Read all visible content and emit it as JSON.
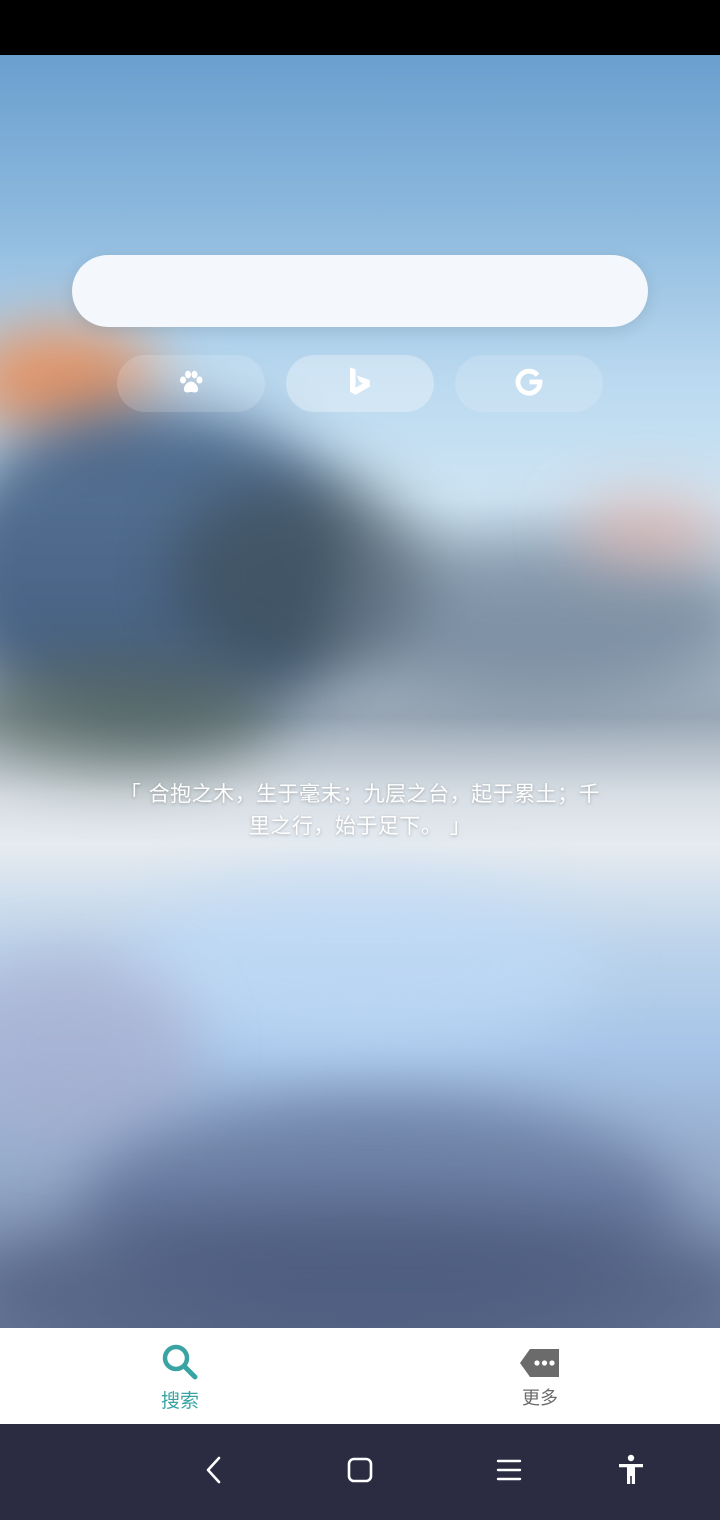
{
  "search": {
    "value": "",
    "placeholder": ""
  },
  "engines": [
    {
      "name": "baidu",
      "icon": "paw-icon",
      "selected": false
    },
    {
      "name": "bing",
      "icon": "bing-logo-icon",
      "selected": true
    },
    {
      "name": "google",
      "icon": "google-logo-icon",
      "selected": false
    }
  ],
  "quote": {
    "text": "「 合抱之木，生于毫末；九层之台，起于累土；千里之行，始于足下。 」"
  },
  "bottom_nav": {
    "tabs": [
      {
        "label": "搜索",
        "icon": "search-icon",
        "active": true,
        "color": "#3aa4a4"
      },
      {
        "label": "更多",
        "icon": "more-tag-icon",
        "active": false,
        "color": "#6b6b6b"
      }
    ]
  },
  "system_nav": {
    "buttons": [
      "back-icon",
      "home-icon",
      "recents-icon",
      "accessibility-icon"
    ]
  },
  "colors": {
    "accent": "#3aa4a4",
    "system_nav_bg": "#2b2c42",
    "status_bar_bg": "#000000"
  }
}
